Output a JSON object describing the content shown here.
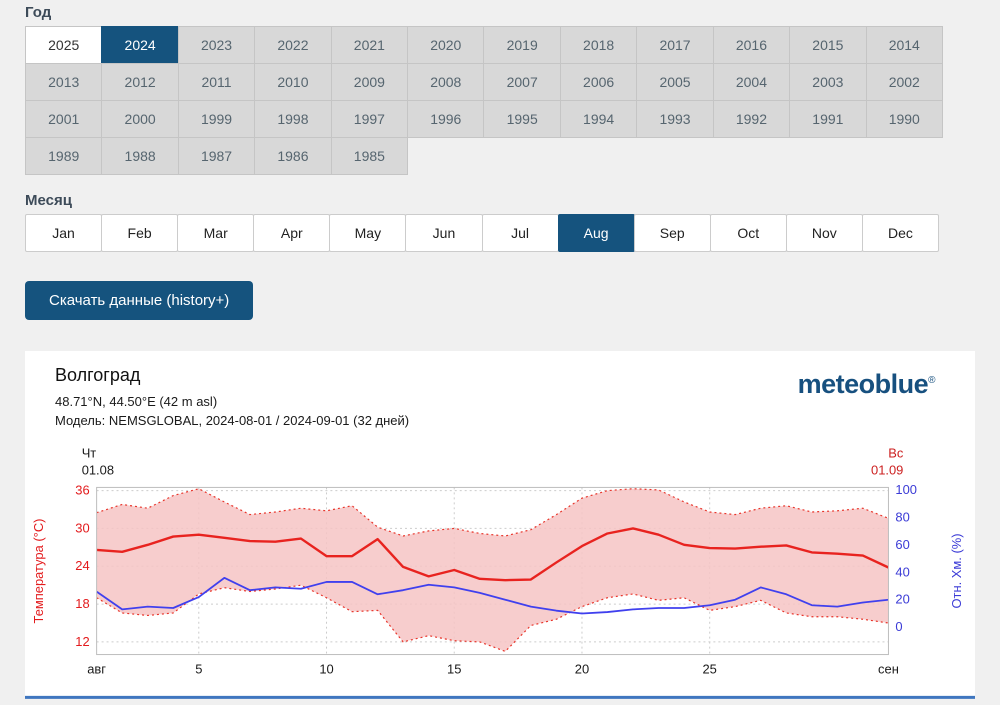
{
  "accent_color": "#15537e",
  "year_section": {
    "label": "Год",
    "years": [
      "2025",
      "2024",
      "2023",
      "2022",
      "2021",
      "2020",
      "2019",
      "2018",
      "2017",
      "2016",
      "2015",
      "2014",
      "2013",
      "2012",
      "2011",
      "2010",
      "2009",
      "2008",
      "2007",
      "2006",
      "2005",
      "2004",
      "2003",
      "2002",
      "2001",
      "2000",
      "1999",
      "1998",
      "1997",
      "1996",
      "1995",
      "1994",
      "1993",
      "1992",
      "1991",
      "1990",
      "1989",
      "1988",
      "1987",
      "1986",
      "1985"
    ],
    "selected_year": "2024",
    "highlight_year": "2025"
  },
  "month_section": {
    "label": "Месяц",
    "months": [
      "Jan",
      "Feb",
      "Mar",
      "Apr",
      "May",
      "Jun",
      "Jul",
      "Aug",
      "Sep",
      "Oct",
      "Nov",
      "Dec"
    ],
    "selected_month": "Aug"
  },
  "download_button_label": "Скачать данные (history+)",
  "chart_header": {
    "title": "Волгоград",
    "coords": "48.71°N, 44.50°E (42 m asl)",
    "model": "Модель: NEMSGLOBAL, 2024-08-01 / 2024-09-01 (32 дней)",
    "brand": "meteoblue",
    "brand_registered": "®"
  },
  "chart_data": {
    "type": "line",
    "title": "Волгоград — NEMSGLOBAL 2024-08-01 / 2024-09-01",
    "start_label": {
      "weekday": "Чт",
      "date": "01.08"
    },
    "end_label": {
      "weekday": "Вс",
      "date": "01.09"
    },
    "x_edge_labels": [
      "авг",
      "сен"
    ],
    "x_ticks": [
      5,
      10,
      15,
      20,
      25
    ],
    "grid": true,
    "left_axis": {
      "label": "Температура (°C)",
      "ticks": [
        12,
        18,
        24,
        30,
        36
      ],
      "range": [
        10,
        36.5
      ],
      "color": "#e31a1c"
    },
    "right_axis": {
      "label": "Отн. Хм. (%)",
      "ticks": [
        0,
        20,
        40,
        60,
        80,
        100
      ],
      "range": [
        -20,
        102
      ],
      "color": "#3b3bd6"
    },
    "band": {
      "upper": "temperature_max",
      "lower": "temperature_min",
      "fill": "#f6c4c4"
    },
    "series": [
      {
        "name": "temperature_mean",
        "axis": "left",
        "color": "#e8231f",
        "values": [
          26.6,
          26.3,
          27.4,
          28.7,
          29.0,
          28.5,
          28.0,
          27.9,
          28.4,
          25.6,
          25.6,
          28.3,
          23.9,
          22.4,
          23.4,
          22.0,
          21.8,
          21.9,
          24.6,
          27.2,
          29.2,
          30.0,
          29.0,
          27.4,
          26.9,
          26.8,
          27.1,
          27.3,
          26.2,
          26.0,
          25.7,
          23.8
        ]
      },
      {
        "name": "temperature_max",
        "axis": "left",
        "color": "#e8342a",
        "style": "dotted",
        "values": [
          32.5,
          33.8,
          33.2,
          35.2,
          36.3,
          34.2,
          32.2,
          32.6,
          33.2,
          32.8,
          33.6,
          30.2,
          28.8,
          29.6,
          30.0,
          29.2,
          28.8,
          29.8,
          32.2,
          34.8,
          36.0,
          36.3,
          36.1,
          34.2,
          32.6,
          32.2,
          33.2,
          33.6,
          32.6,
          32.8,
          33.2,
          31.6
        ]
      },
      {
        "name": "temperature_min",
        "axis": "left",
        "color": "#e8342a",
        "style": "dotted",
        "values": [
          19.0,
          16.6,
          16.2,
          16.6,
          19.6,
          20.6,
          20.0,
          20.4,
          21.0,
          19.0,
          16.8,
          17.0,
          12.0,
          13.0,
          12.2,
          12.0,
          10.5,
          14.6,
          15.6,
          17.6,
          19.0,
          19.6,
          18.6,
          19.0,
          17.0,
          17.6,
          18.6,
          16.6,
          16.0,
          16.0,
          15.6,
          15.0
        ]
      },
      {
        "name": "relative_humidity",
        "axis": "right",
        "color": "#4040ee",
        "values": [
          26,
          13,
          15,
          14,
          22,
          36,
          27,
          29,
          28,
          33,
          33,
          24,
          27,
          31,
          29,
          25,
          20,
          15,
          12,
          10,
          11,
          13,
          14,
          14,
          16,
          20,
          29,
          24,
          16,
          15,
          18,
          20
        ]
      }
    ]
  }
}
